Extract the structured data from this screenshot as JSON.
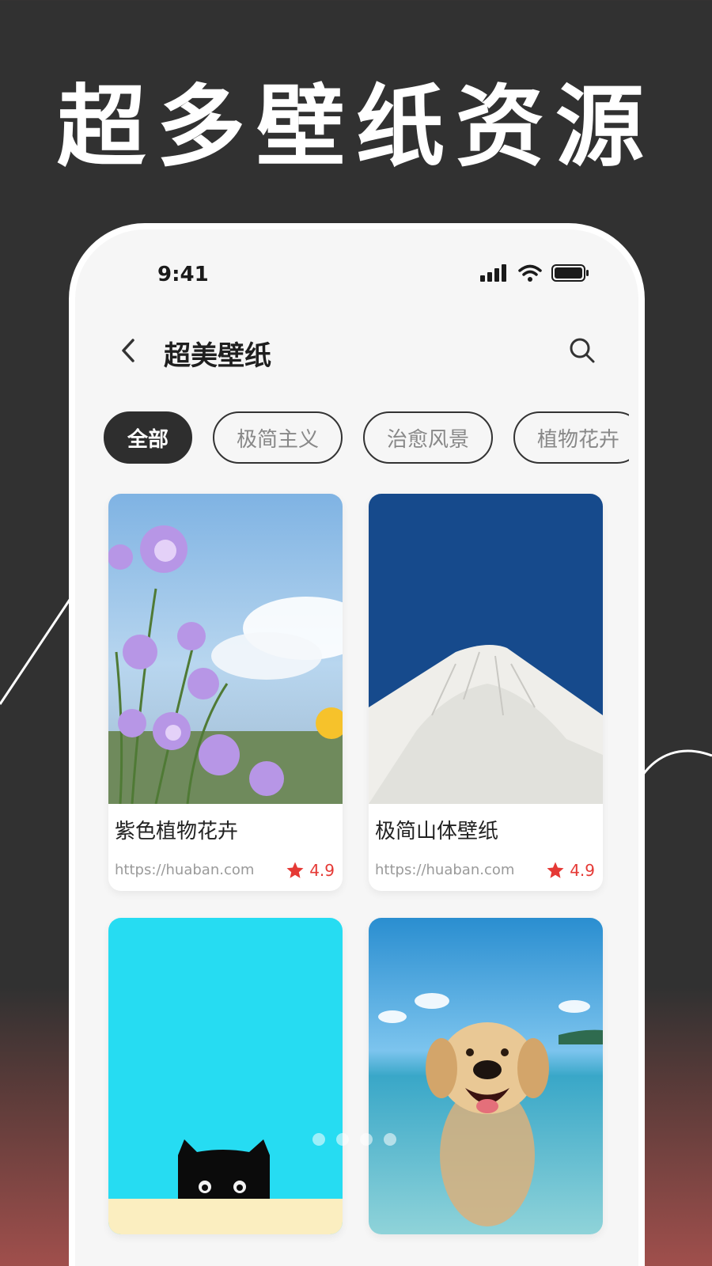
{
  "hero": {
    "title": "超多壁纸资源"
  },
  "status_bar": {
    "time": "9:41"
  },
  "nav": {
    "title": "超美壁纸"
  },
  "tabs": [
    {
      "label": "全部",
      "active": true
    },
    {
      "label": "极简主义",
      "active": false
    },
    {
      "label": "治愈风景",
      "active": false
    },
    {
      "label": "植物花卉",
      "active": false
    }
  ],
  "cards": [
    {
      "title": "紫色植物花卉",
      "url": "https://huaban.com",
      "rating": "4.9",
      "image": "purple-flowers-sky"
    },
    {
      "title": "极简山体壁纸",
      "url": "https://huaban.com",
      "rating": "4.9",
      "image": "white-mountain-blue-sky"
    },
    {
      "title": "",
      "url": "",
      "rating": "",
      "image": "black-cat-cyan-background"
    },
    {
      "title": "",
      "url": "",
      "rating": "",
      "image": "dog-swimming-ocean"
    }
  ],
  "carousel": {
    "dots": 4
  },
  "colors": {
    "background": "#313131",
    "accent_red": "#e53935",
    "active_tab": "#2e2e2e",
    "cat_background": "#26dcf2",
    "mountain_sky": "#164a8c"
  }
}
